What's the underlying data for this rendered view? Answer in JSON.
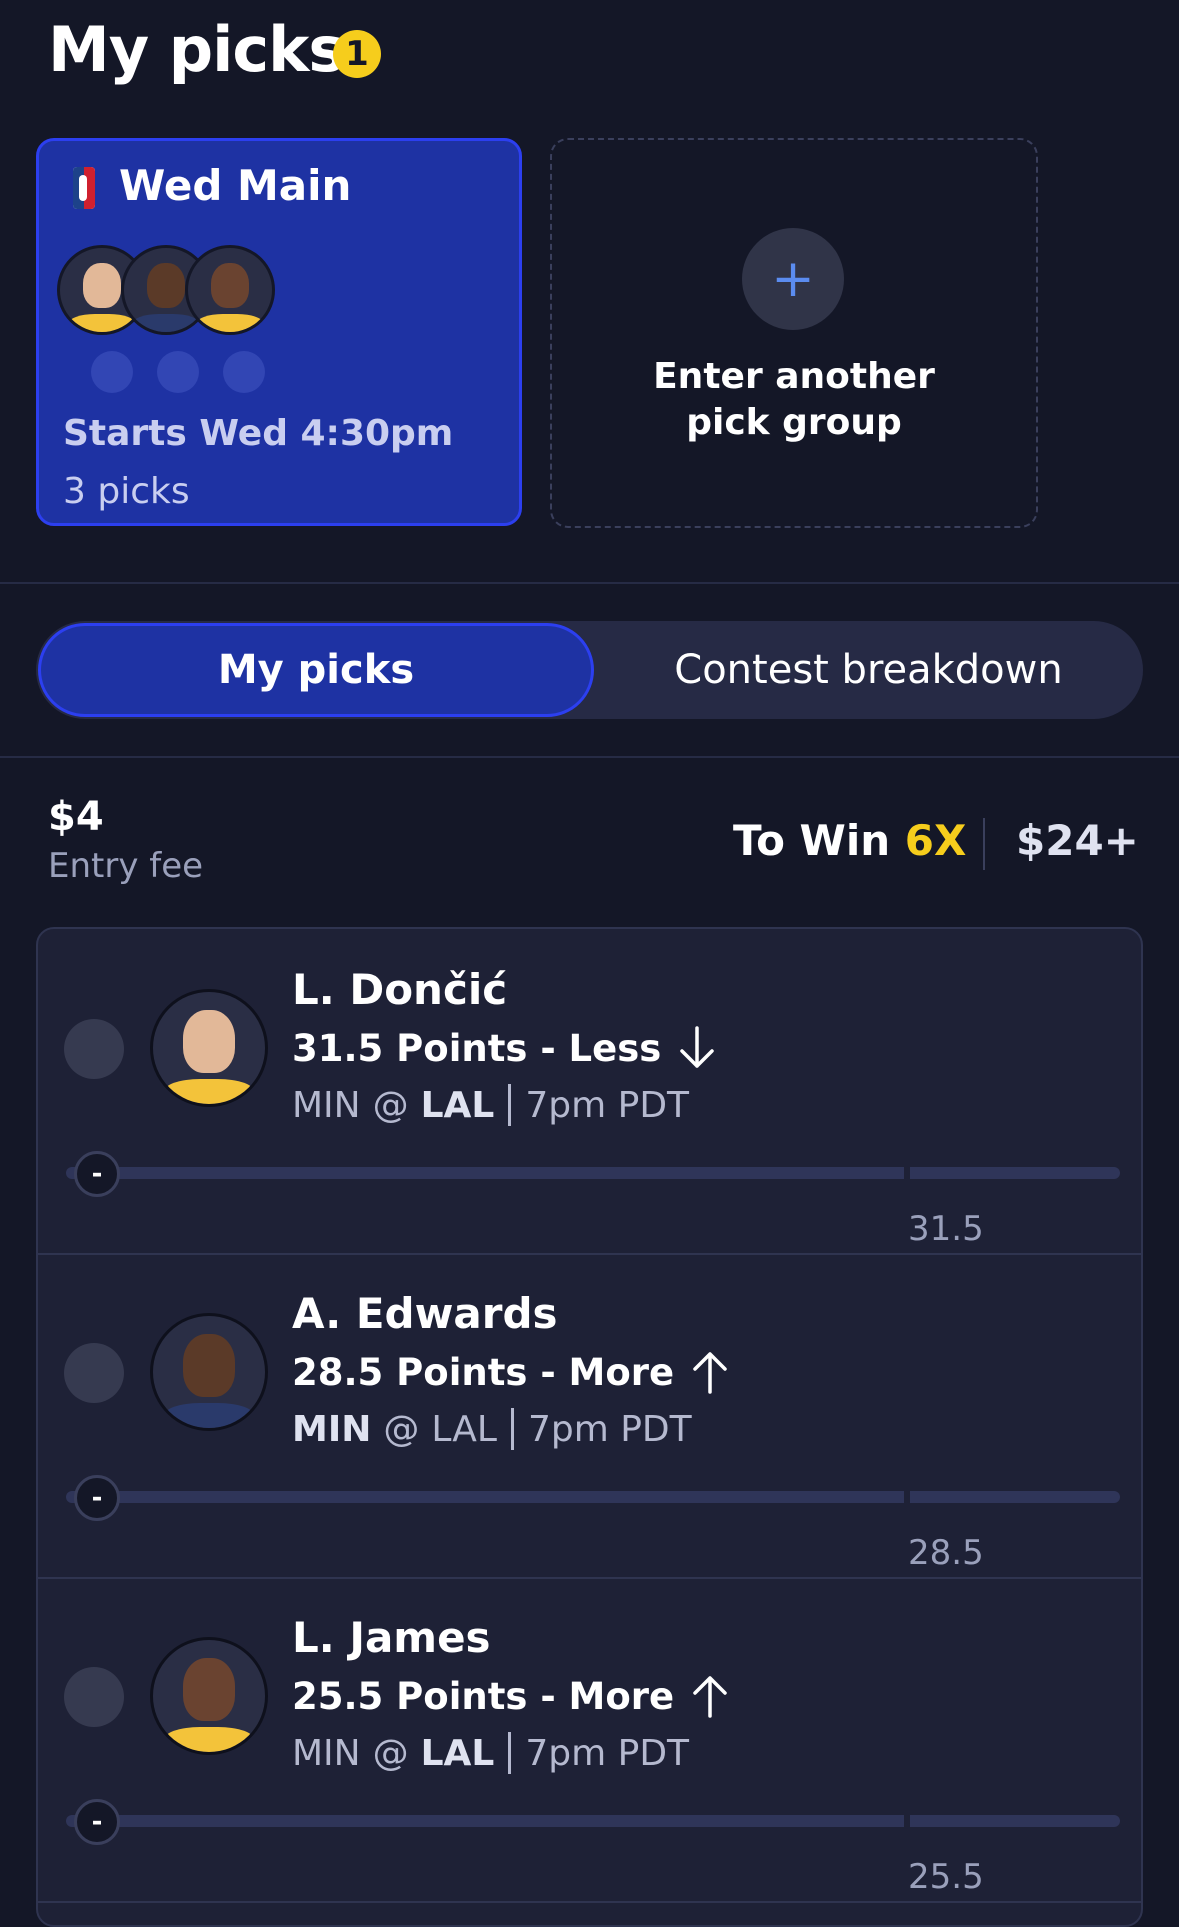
{
  "header": {
    "title": "My picks",
    "badge_count": "1"
  },
  "group_card": {
    "league_icon": "nba-logo-icon",
    "title": "Wed Main",
    "player_avatars": [
      "L. Dončić",
      "A. Edwards",
      "L. James"
    ],
    "starts": "Starts Wed 4:30pm",
    "picks_count": "3 picks"
  },
  "add_group": {
    "icon": "plus-icon",
    "label_line1": "Enter another",
    "label_line2": "pick group"
  },
  "tabs": {
    "active": "My picks",
    "inactive": "Contest breakdown"
  },
  "entry": {
    "fee_amount": "$4",
    "fee_label": "Entry fee",
    "to_win_label": "To Win",
    "multiplier": "6X",
    "payout": "$24+"
  },
  "picks": [
    {
      "name": "L. Dončić",
      "line": "31.5 Points - Less",
      "direction": "down",
      "away": "MIN",
      "at": "@",
      "home": "LAL",
      "bold_team": "home",
      "time": "7pm PDT",
      "knob": "-",
      "target": "31.5",
      "skin": "#e2b898",
      "shirt": "#f3c33a"
    },
    {
      "name": "A. Edwards",
      "line": "28.5 Points - More",
      "direction": "up",
      "away": "MIN",
      "at": "@",
      "home": "LAL",
      "bold_team": "away",
      "time": "7pm PDT",
      "knob": "-",
      "target": "28.5",
      "skin": "#5b3a28",
      "shirt": "#2a3a6b"
    },
    {
      "name": "L. James",
      "line": "25.5 Points - More",
      "direction": "up",
      "away": "MIN",
      "at": "@",
      "home": "LAL",
      "bold_team": "home",
      "time": "7pm PDT",
      "knob": "-",
      "target": "25.5",
      "skin": "#6a4330",
      "shirt": "#f3c33a"
    }
  ],
  "colors": {
    "background": "#141727",
    "accent_blue": "#1e32a3",
    "accent_yellow": "#f6cd1c"
  }
}
